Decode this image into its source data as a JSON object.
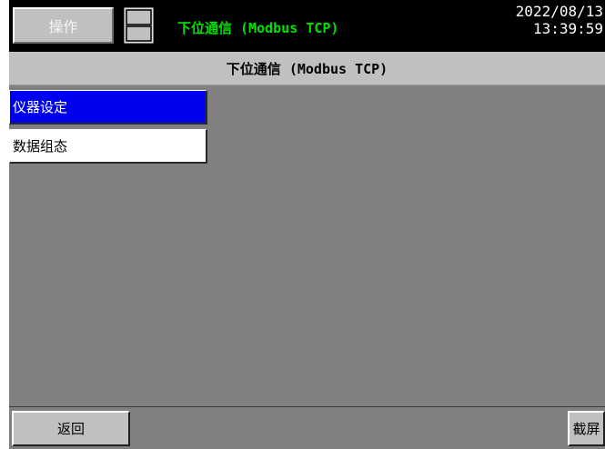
{
  "header": {
    "operate_label": "操作",
    "screen_title": "下位通信 (Modbus TCP)",
    "date": "2022/08/13",
    "time": "13:39:59"
  },
  "title_strip": {
    "text": "下位通信 (Modbus TCP)"
  },
  "menu": {
    "items": [
      {
        "label": "仪器设定",
        "selected": true
      },
      {
        "label": "数据组态",
        "selected": false
      }
    ]
  },
  "footer": {
    "back_label": "返回",
    "screenshot_label": "截屏"
  },
  "colors": {
    "topbar": "#000000",
    "title_text": "#00e000",
    "selected_item": "#0000f0",
    "background": "#808080",
    "button_face": "#c0c0c0"
  },
  "icons": {
    "save": "floppy-disk-icon"
  }
}
